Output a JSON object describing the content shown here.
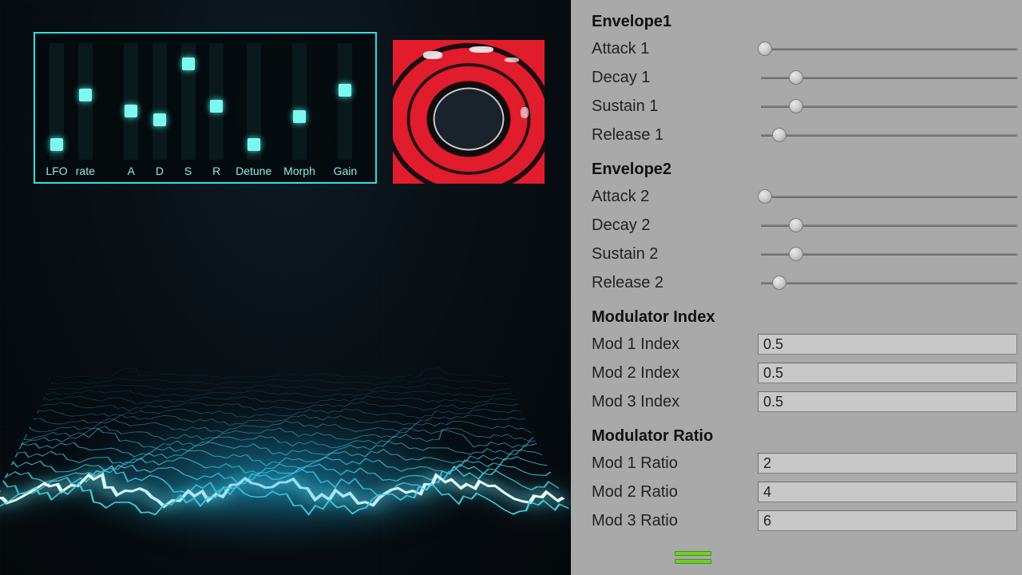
{
  "faders": [
    {
      "label": "LFO",
      "level": 0.08,
      "width": "narrow"
    },
    {
      "label": "rate",
      "level": 0.55,
      "width": "narrow"
    },
    {
      "label": "A",
      "level": 0.4,
      "width": "narrow"
    },
    {
      "label": "D",
      "level": 0.32,
      "width": "narrow"
    },
    {
      "label": "S",
      "level": 0.85,
      "width": "narrow"
    },
    {
      "label": "R",
      "level": 0.45,
      "width": "narrow"
    },
    {
      "label": "Detune",
      "level": 0.08,
      "width": "wide"
    },
    {
      "label": "Morph",
      "level": 0.35,
      "width": "wide"
    },
    {
      "label": "Gain",
      "level": 0.6,
      "width": "wide"
    }
  ],
  "envelope1": {
    "title": "Envelope1",
    "params": [
      {
        "label": "Attack 1",
        "value": 0.0
      },
      {
        "label": "Decay 1",
        "value": 0.13
      },
      {
        "label": "Sustain 1",
        "value": 0.13
      },
      {
        "label": "Release 1",
        "value": 0.06
      }
    ]
  },
  "envelope2": {
    "title": "Envelope2",
    "params": [
      {
        "label": "Attack 2",
        "value": 0.0
      },
      {
        "label": "Decay 2",
        "value": 0.13
      },
      {
        "label": "Sustain 2",
        "value": 0.13
      },
      {
        "label": "Release 2",
        "value": 0.06
      }
    ]
  },
  "mod_index": {
    "title": "Modulator Index",
    "params": [
      {
        "label": "Mod 1 Index",
        "value": "0.5"
      },
      {
        "label": "Mod 2 Index",
        "value": "0.5"
      },
      {
        "label": "Mod 3 Index",
        "value": "0.5"
      }
    ]
  },
  "mod_ratio": {
    "title": "Modulator Ratio",
    "params": [
      {
        "label": "Mod 1 Ratio",
        "value": "2"
      },
      {
        "label": "Mod 2 Ratio",
        "value": "4"
      },
      {
        "label": "Mod 3 Ratio",
        "value": "6"
      }
    ]
  },
  "meter_levels": [
    0.35,
    0.35
  ],
  "colors": {
    "accent_cyan": "#2de0e6",
    "accent_glow": "#7ef7ee",
    "panel_grey": "#a9a9a9",
    "preview_red": "#e11c2d"
  },
  "waveform_rows": 18
}
